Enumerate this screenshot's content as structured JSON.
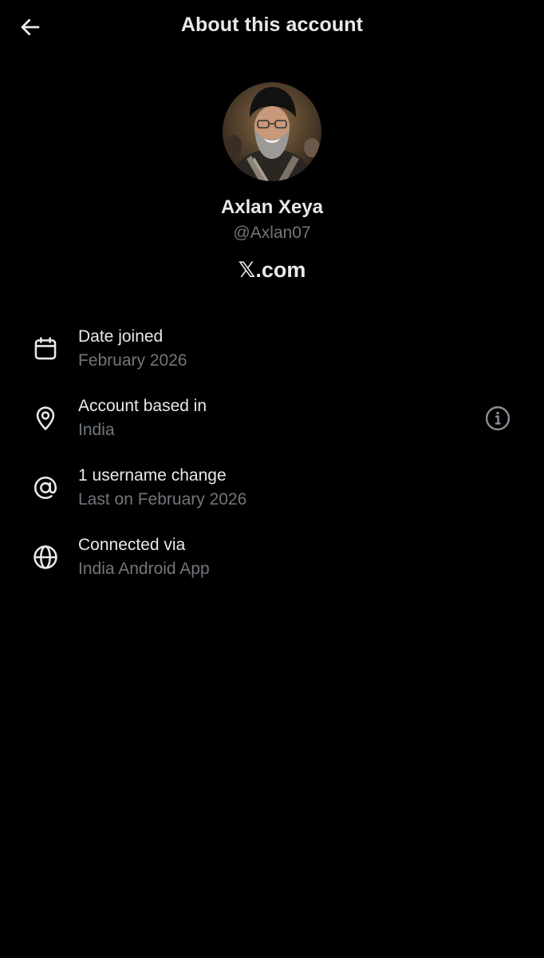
{
  "header": {
    "title": "About this account"
  },
  "profile": {
    "display_name": "Axlan Xeya",
    "handle": "@Axlan07",
    "site": "𝕏.com"
  },
  "rows": [
    {
      "icon": "calendar-icon",
      "title": "Date joined",
      "value": "February 2026"
    },
    {
      "icon": "location-pin-icon",
      "title": "Account based in",
      "value": "India"
    },
    {
      "icon": "at-sign-icon",
      "title": "1 username change",
      "value": "Last on February 2026"
    },
    {
      "icon": "globe-icon",
      "title": "Connected via",
      "value": "India Android App"
    }
  ],
  "colors": {
    "background": "#000000",
    "primary_text": "#e7e9ea",
    "secondary_text": "#71767b"
  }
}
